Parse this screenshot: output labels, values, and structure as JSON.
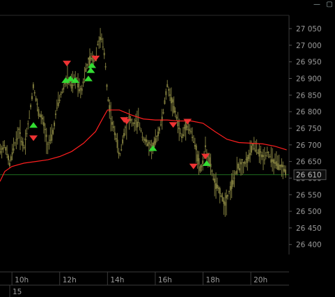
{
  "window": {
    "buttons": [
      {
        "name": "minimize-button",
        "glyph": "—"
      },
      {
        "name": "maximize-button",
        "glyph": "▢"
      }
    ]
  },
  "chart_data": {
    "type": "line",
    "y_ticks": [
      "26 400",
      "26 450",
      "26 500",
      "26 550",
      "26 600",
      "26 650",
      "26 700",
      "26 750",
      "26 800",
      "26 850",
      "26 900",
      "26 950",
      "27 000",
      "27 050"
    ],
    "ylim": [
      26370,
      27090
    ],
    "x_ticks": [
      {
        "label": "10h",
        "hour": 10
      },
      {
        "label": "12h",
        "hour": 12
      },
      {
        "label": "14h",
        "hour": 14
      },
      {
        "label": "16h",
        "hour": 16
      },
      {
        "label": "18h",
        "hour": 18
      },
      {
        "label": "20h",
        "hour": 20
      }
    ],
    "date_label": "15",
    "xlim_hours": [
      9.5,
      21.6
    ],
    "current_price": {
      "label": "26 610",
      "value": 26610
    },
    "colors": {
      "price": "#7d7a3c",
      "moving_average": "#ff1f1f",
      "buy": "#33dd33",
      "sell": "#ee3333",
      "current_line": "#1f6b1f"
    },
    "series": [
      {
        "kind": "price",
        "points": [
          [
            9.5,
            26680
          ],
          [
            9.7,
            26700
          ],
          [
            9.9,
            26640
          ],
          [
            10.1,
            26700
          ],
          [
            10.3,
            26740
          ],
          [
            10.5,
            26690
          ],
          [
            10.7,
            26770
          ],
          [
            10.9,
            26880
          ],
          [
            11.1,
            26800
          ],
          [
            11.3,
            26770
          ],
          [
            11.5,
            26700
          ],
          [
            11.7,
            26730
          ],
          [
            11.9,
            26820
          ],
          [
            12.1,
            26860
          ],
          [
            12.3,
            26900
          ],
          [
            12.5,
            26880
          ],
          [
            12.7,
            26900
          ],
          [
            12.9,
            26860
          ],
          [
            13.1,
            26930
          ],
          [
            13.3,
            26960
          ],
          [
            13.5,
            26960
          ],
          [
            13.6,
            27010
          ],
          [
            13.75,
            27020
          ],
          [
            13.9,
            26960
          ],
          [
            14.0,
            26850
          ],
          [
            14.2,
            26760
          ],
          [
            14.35,
            26730
          ],
          [
            14.5,
            26660
          ],
          [
            14.7,
            26740
          ],
          [
            14.9,
            26780
          ],
          [
            15.1,
            26760
          ],
          [
            15.3,
            26770
          ],
          [
            15.5,
            26720
          ],
          [
            15.7,
            26700
          ],
          [
            15.9,
            26690
          ],
          [
            16.1,
            26730
          ],
          [
            16.3,
            26780
          ],
          [
            16.5,
            26880
          ],
          [
            16.7,
            26830
          ],
          [
            16.9,
            26780
          ],
          [
            17.1,
            26720
          ],
          [
            17.3,
            26760
          ],
          [
            17.5,
            26740
          ],
          [
            17.7,
            26690
          ],
          [
            17.9,
            26620
          ],
          [
            18.1,
            26690
          ],
          [
            18.3,
            26640
          ],
          [
            18.5,
            26580
          ],
          [
            18.7,
            26560
          ],
          [
            18.9,
            26520
          ],
          [
            19.1,
            26560
          ],
          [
            19.3,
            26600
          ],
          [
            19.5,
            26640
          ],
          [
            19.7,
            26640
          ],
          [
            19.9,
            26660
          ],
          [
            20.1,
            26700
          ],
          [
            20.3,
            26680
          ],
          [
            20.5,
            26660
          ],
          [
            20.7,
            26680
          ],
          [
            20.9,
            26650
          ],
          [
            21.1,
            26640
          ],
          [
            21.3,
            26630
          ],
          [
            21.5,
            26620
          ]
        ]
      },
      {
        "kind": "moving_average",
        "points": [
          [
            9.5,
            26590
          ],
          [
            9.7,
            26620
          ],
          [
            10.0,
            26635
          ],
          [
            10.5,
            26645
          ],
          [
            11.0,
            26650
          ],
          [
            11.5,
            26655
          ],
          [
            12.0,
            26665
          ],
          [
            12.5,
            26680
          ],
          [
            13.0,
            26705
          ],
          [
            13.5,
            26740
          ],
          [
            13.8,
            26780
          ],
          [
            14.0,
            26805
          ],
          [
            14.5,
            26805
          ],
          [
            15.0,
            26790
          ],
          [
            15.5,
            26778
          ],
          [
            16.0,
            26775
          ],
          [
            16.5,
            26775
          ],
          [
            17.0,
            26772
          ],
          [
            17.5,
            26772
          ],
          [
            18.0,
            26765
          ],
          [
            18.5,
            26740
          ],
          [
            19.0,
            26717
          ],
          [
            19.5,
            26707
          ],
          [
            20.0,
            26705
          ],
          [
            20.5,
            26703
          ],
          [
            21.0,
            26696
          ],
          [
            21.5,
            26685
          ]
        ]
      }
    ],
    "signals": [
      {
        "type": "buy",
        "hour": 10.9,
        "value": 26760
      },
      {
        "type": "sell",
        "hour": 10.9,
        "value": 26720
      },
      {
        "type": "sell",
        "hour": 12.3,
        "value": 26945
      },
      {
        "type": "buy",
        "hour": 12.25,
        "value": 26895
      },
      {
        "type": "buy",
        "hour": 12.45,
        "value": 26900
      },
      {
        "type": "buy",
        "hour": 12.65,
        "value": 26895
      },
      {
        "type": "buy",
        "hour": 13.2,
        "value": 26900
      },
      {
        "type": "buy",
        "hour": 13.3,
        "value": 26925
      },
      {
        "type": "buy",
        "hour": 13.35,
        "value": 26940
      },
      {
        "type": "sell",
        "hour": 13.5,
        "value": 26960
      },
      {
        "type": "sell",
        "hour": 14.7,
        "value": 26775
      },
      {
        "type": "sell",
        "hour": 14.8,
        "value": 26770
      },
      {
        "type": "buy",
        "hour": 15.9,
        "value": 26690
      },
      {
        "type": "sell",
        "hour": 16.75,
        "value": 26760
      },
      {
        "type": "sell",
        "hour": 17.35,
        "value": 26770
      },
      {
        "type": "sell",
        "hour": 17.6,
        "value": 26635
      },
      {
        "type": "sell",
        "hour": 18.1,
        "value": 26665
      },
      {
        "type": "buy",
        "hour": 18.15,
        "value": 26645
      }
    ]
  }
}
